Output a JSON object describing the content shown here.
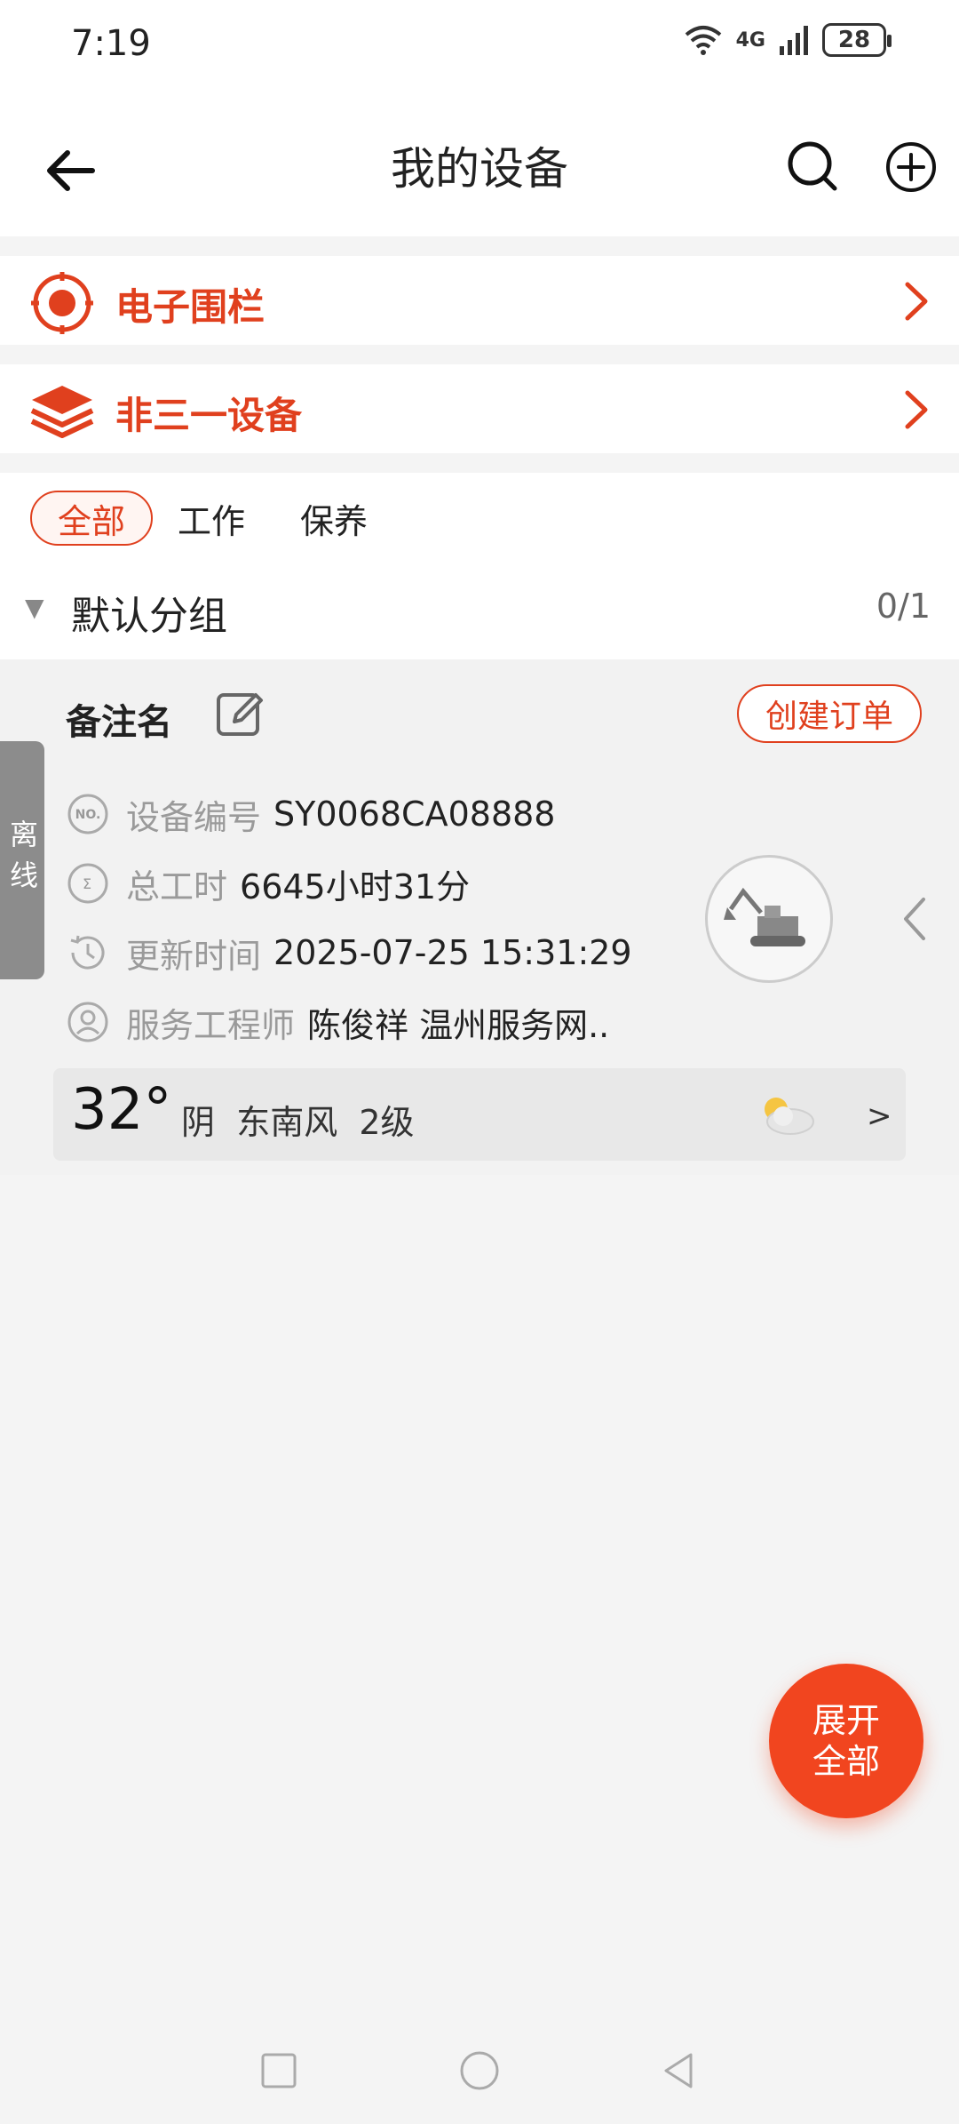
{
  "status_bar": {
    "time": "7:19",
    "network": "4G",
    "battery": "28"
  },
  "header": {
    "title": "我的设备"
  },
  "menu": [
    {
      "label": "电子围栏",
      "icon": "target-icon"
    },
    {
      "label": "非三一设备",
      "icon": "layers-icon"
    }
  ],
  "filters": {
    "tabs": [
      "全部",
      "工作",
      "保养"
    ],
    "active": "全部"
  },
  "group": {
    "name": "默认分组",
    "count": "0/1"
  },
  "device": {
    "alias": "备注名",
    "create_order": "创建订单",
    "status": "离线",
    "info": [
      {
        "label": "设备编号",
        "value": "SY0068CA08888"
      },
      {
        "label": "总工时",
        "value": "6645小时31分"
      },
      {
        "label": "更新时间",
        "value": "2025-07-25 15:31:29"
      },
      {
        "label": "服务工程师",
        "value": "陈俊祥 温州服务网.."
      }
    ],
    "weather": {
      "temp": "32°",
      "condition": "阴",
      "wind": "东南风",
      "level": "2级",
      "more": ">"
    }
  },
  "fab": {
    "line1": "展开",
    "line2": "全部"
  },
  "colors": {
    "accent": "#e0401e",
    "fab": "#f1451f"
  }
}
